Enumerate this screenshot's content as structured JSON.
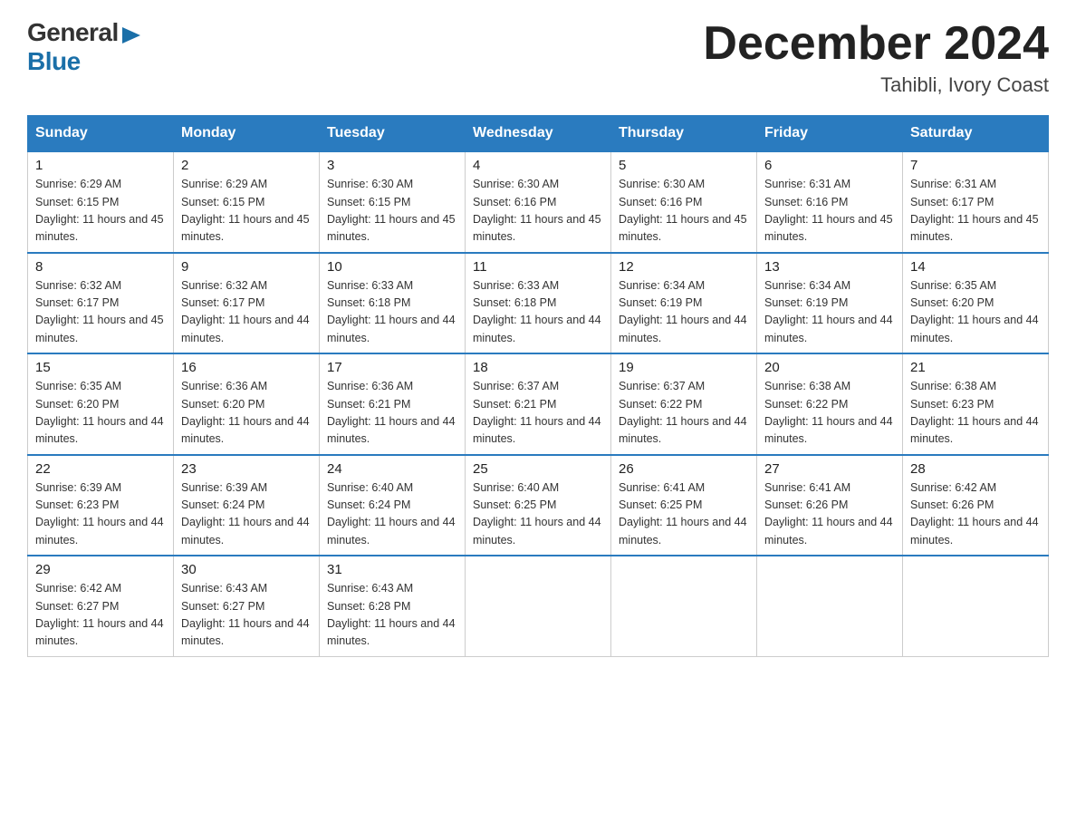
{
  "header": {
    "logo": {
      "general": "General",
      "blue": "Blue"
    },
    "title": "December 2024",
    "location": "Tahibli, Ivory Coast"
  },
  "calendar": {
    "days_of_week": [
      "Sunday",
      "Monday",
      "Tuesday",
      "Wednesday",
      "Thursday",
      "Friday",
      "Saturday"
    ],
    "weeks": [
      [
        {
          "day": "1",
          "sunrise": "6:29 AM",
          "sunset": "6:15 PM",
          "daylight": "11 hours and 45 minutes."
        },
        {
          "day": "2",
          "sunrise": "6:29 AM",
          "sunset": "6:15 PM",
          "daylight": "11 hours and 45 minutes."
        },
        {
          "day": "3",
          "sunrise": "6:30 AM",
          "sunset": "6:15 PM",
          "daylight": "11 hours and 45 minutes."
        },
        {
          "day": "4",
          "sunrise": "6:30 AM",
          "sunset": "6:16 PM",
          "daylight": "11 hours and 45 minutes."
        },
        {
          "day": "5",
          "sunrise": "6:30 AM",
          "sunset": "6:16 PM",
          "daylight": "11 hours and 45 minutes."
        },
        {
          "day": "6",
          "sunrise": "6:31 AM",
          "sunset": "6:16 PM",
          "daylight": "11 hours and 45 minutes."
        },
        {
          "day": "7",
          "sunrise": "6:31 AM",
          "sunset": "6:17 PM",
          "daylight": "11 hours and 45 minutes."
        }
      ],
      [
        {
          "day": "8",
          "sunrise": "6:32 AM",
          "sunset": "6:17 PM",
          "daylight": "11 hours and 45 minutes."
        },
        {
          "day": "9",
          "sunrise": "6:32 AM",
          "sunset": "6:17 PM",
          "daylight": "11 hours and 44 minutes."
        },
        {
          "day": "10",
          "sunrise": "6:33 AM",
          "sunset": "6:18 PM",
          "daylight": "11 hours and 44 minutes."
        },
        {
          "day": "11",
          "sunrise": "6:33 AM",
          "sunset": "6:18 PM",
          "daylight": "11 hours and 44 minutes."
        },
        {
          "day": "12",
          "sunrise": "6:34 AM",
          "sunset": "6:19 PM",
          "daylight": "11 hours and 44 minutes."
        },
        {
          "day": "13",
          "sunrise": "6:34 AM",
          "sunset": "6:19 PM",
          "daylight": "11 hours and 44 minutes."
        },
        {
          "day": "14",
          "sunrise": "6:35 AM",
          "sunset": "6:20 PM",
          "daylight": "11 hours and 44 minutes."
        }
      ],
      [
        {
          "day": "15",
          "sunrise": "6:35 AM",
          "sunset": "6:20 PM",
          "daylight": "11 hours and 44 minutes."
        },
        {
          "day": "16",
          "sunrise": "6:36 AM",
          "sunset": "6:20 PM",
          "daylight": "11 hours and 44 minutes."
        },
        {
          "day": "17",
          "sunrise": "6:36 AM",
          "sunset": "6:21 PM",
          "daylight": "11 hours and 44 minutes."
        },
        {
          "day": "18",
          "sunrise": "6:37 AM",
          "sunset": "6:21 PM",
          "daylight": "11 hours and 44 minutes."
        },
        {
          "day": "19",
          "sunrise": "6:37 AM",
          "sunset": "6:22 PM",
          "daylight": "11 hours and 44 minutes."
        },
        {
          "day": "20",
          "sunrise": "6:38 AM",
          "sunset": "6:22 PM",
          "daylight": "11 hours and 44 minutes."
        },
        {
          "day": "21",
          "sunrise": "6:38 AM",
          "sunset": "6:23 PM",
          "daylight": "11 hours and 44 minutes."
        }
      ],
      [
        {
          "day": "22",
          "sunrise": "6:39 AM",
          "sunset": "6:23 PM",
          "daylight": "11 hours and 44 minutes."
        },
        {
          "day": "23",
          "sunrise": "6:39 AM",
          "sunset": "6:24 PM",
          "daylight": "11 hours and 44 minutes."
        },
        {
          "day": "24",
          "sunrise": "6:40 AM",
          "sunset": "6:24 PM",
          "daylight": "11 hours and 44 minutes."
        },
        {
          "day": "25",
          "sunrise": "6:40 AM",
          "sunset": "6:25 PM",
          "daylight": "11 hours and 44 minutes."
        },
        {
          "day": "26",
          "sunrise": "6:41 AM",
          "sunset": "6:25 PM",
          "daylight": "11 hours and 44 minutes."
        },
        {
          "day": "27",
          "sunrise": "6:41 AM",
          "sunset": "6:26 PM",
          "daylight": "11 hours and 44 minutes."
        },
        {
          "day": "28",
          "sunrise": "6:42 AM",
          "sunset": "6:26 PM",
          "daylight": "11 hours and 44 minutes."
        }
      ],
      [
        {
          "day": "29",
          "sunrise": "6:42 AM",
          "sunset": "6:27 PM",
          "daylight": "11 hours and 44 minutes."
        },
        {
          "day": "30",
          "sunrise": "6:43 AM",
          "sunset": "6:27 PM",
          "daylight": "11 hours and 44 minutes."
        },
        {
          "day": "31",
          "sunrise": "6:43 AM",
          "sunset": "6:28 PM",
          "daylight": "11 hours and 44 minutes."
        },
        null,
        null,
        null,
        null
      ]
    ],
    "labels": {
      "sunrise": "Sunrise:",
      "sunset": "Sunset:",
      "daylight": "Daylight:"
    }
  }
}
